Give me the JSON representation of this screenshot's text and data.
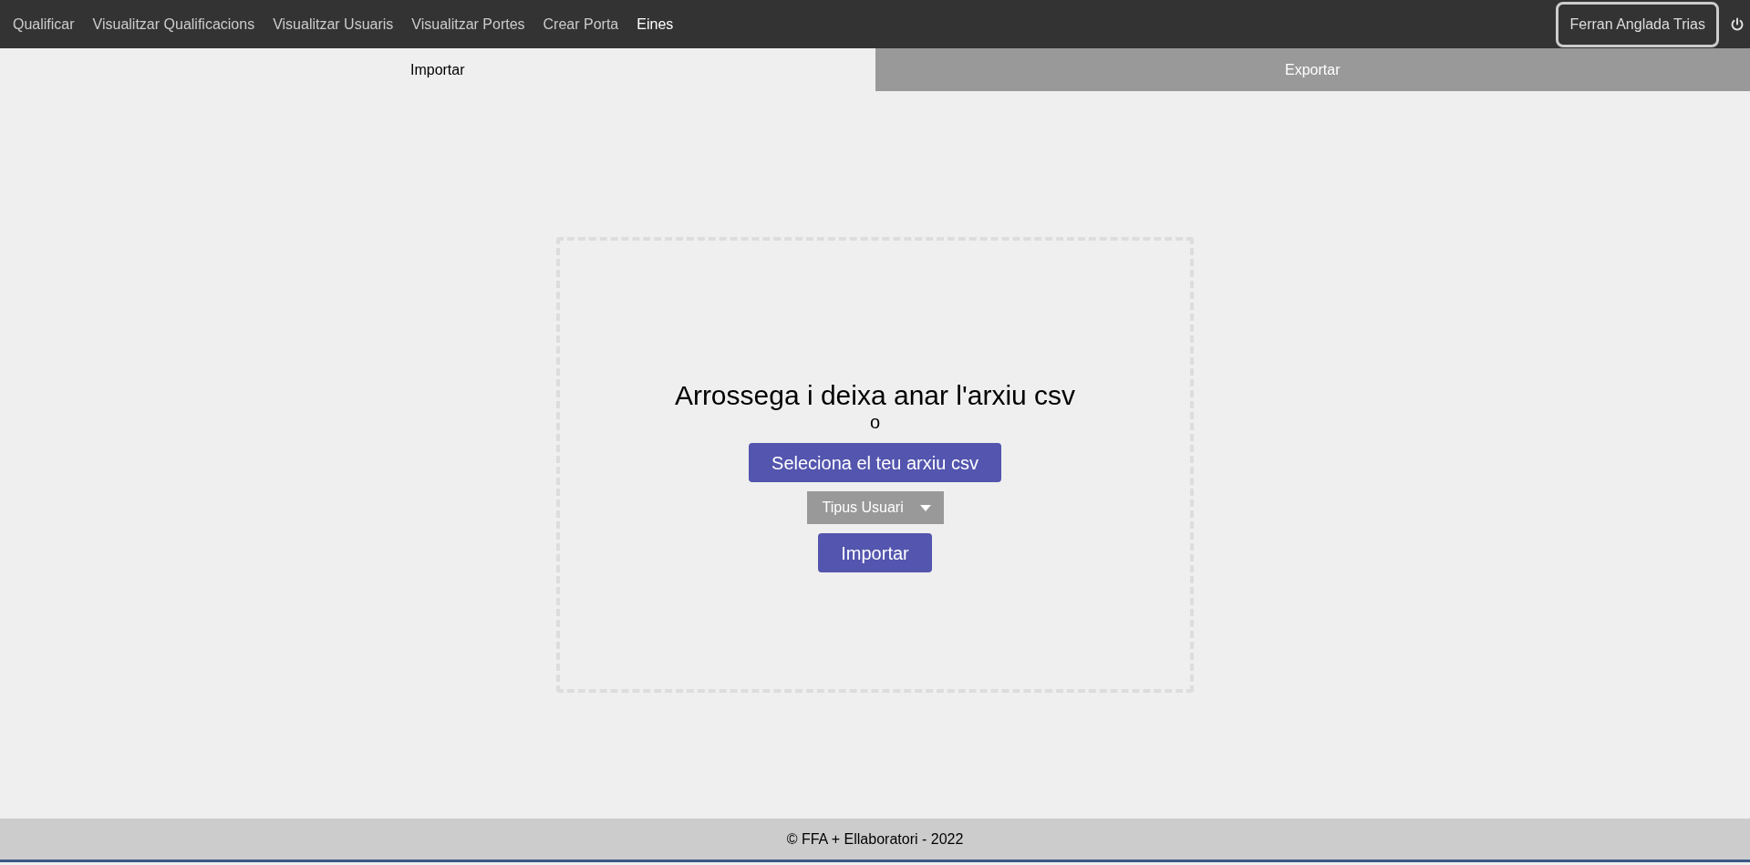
{
  "nav": {
    "items": [
      {
        "label": "Qualificar",
        "selected": false
      },
      {
        "label": "Visualitzar Qualificacions",
        "selected": false
      },
      {
        "label": "Visualitzar Usuaris",
        "selected": false
      },
      {
        "label": "Visualitzar Portes",
        "selected": false
      },
      {
        "label": "Crear Porta",
        "selected": false
      },
      {
        "label": "Eines",
        "selected": true
      }
    ],
    "user": "Ferran Anglada Trias"
  },
  "tabs": [
    {
      "label": "Importar",
      "selected": true
    },
    {
      "label": "Exportar",
      "selected": false
    }
  ],
  "dropzone": {
    "heading": "Arrossega i deixa anar l'arxiu csv",
    "separator": "o",
    "select_button": "Seleciona el teu arxiu csv",
    "user_type": "Tipus Usuari",
    "import_button": "Importar"
  },
  "footer": "© FFA + Ellaboratori - 2022"
}
